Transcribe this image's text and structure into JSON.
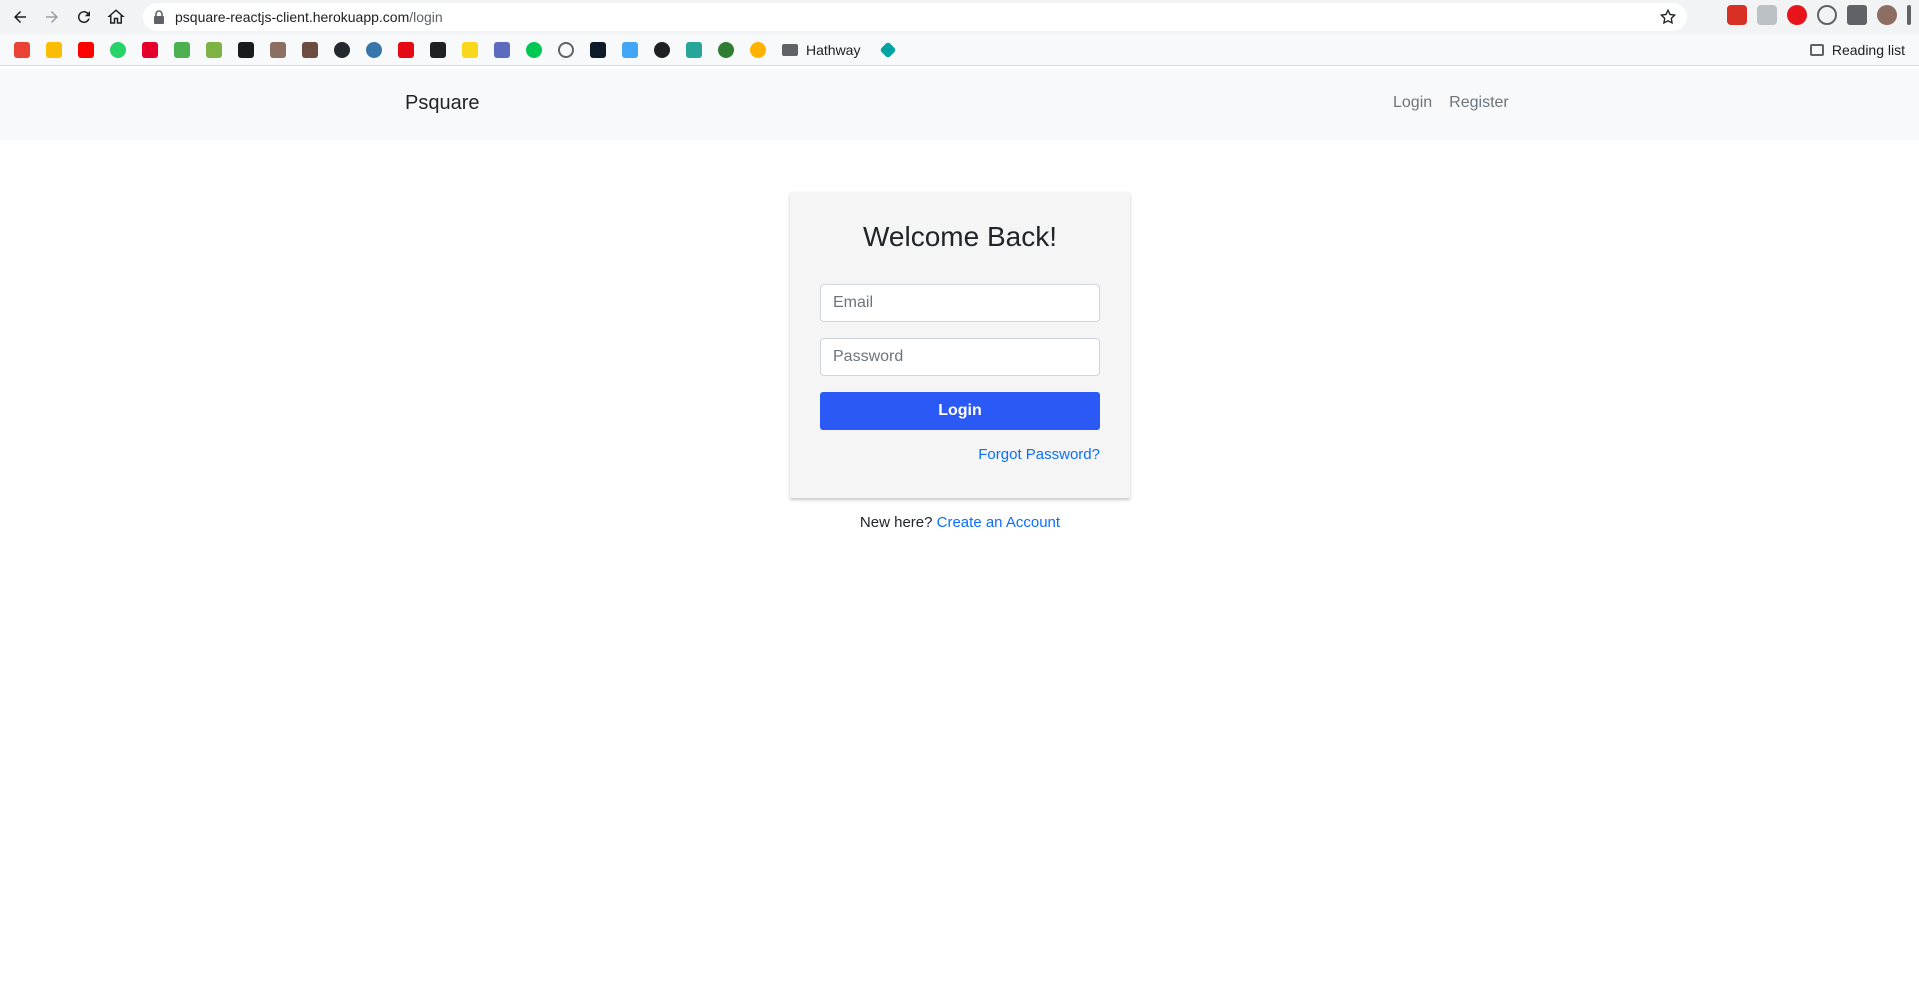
{
  "browser": {
    "url_host": "psquare-reactjs-client.herokuapp.com",
    "url_path": "/login",
    "bookmark_folder": "Hathway",
    "reading_list": "Reading list"
  },
  "navbar": {
    "brand": "Psquare",
    "links": [
      "Login",
      "Register"
    ]
  },
  "login_card": {
    "title": "Welcome Back!",
    "email_placeholder": "Email",
    "password_placeholder": "Password",
    "login_button": "Login",
    "forgot_password": "Forgot Password?"
  },
  "signup": {
    "prompt": "New here?",
    "link": "Create an Account"
  },
  "colors": {
    "primary_button": "#2b59f5",
    "link": "#0d6efd",
    "navbar_bg": "#f8f9fa",
    "card_bg": "#f5f5f5"
  }
}
